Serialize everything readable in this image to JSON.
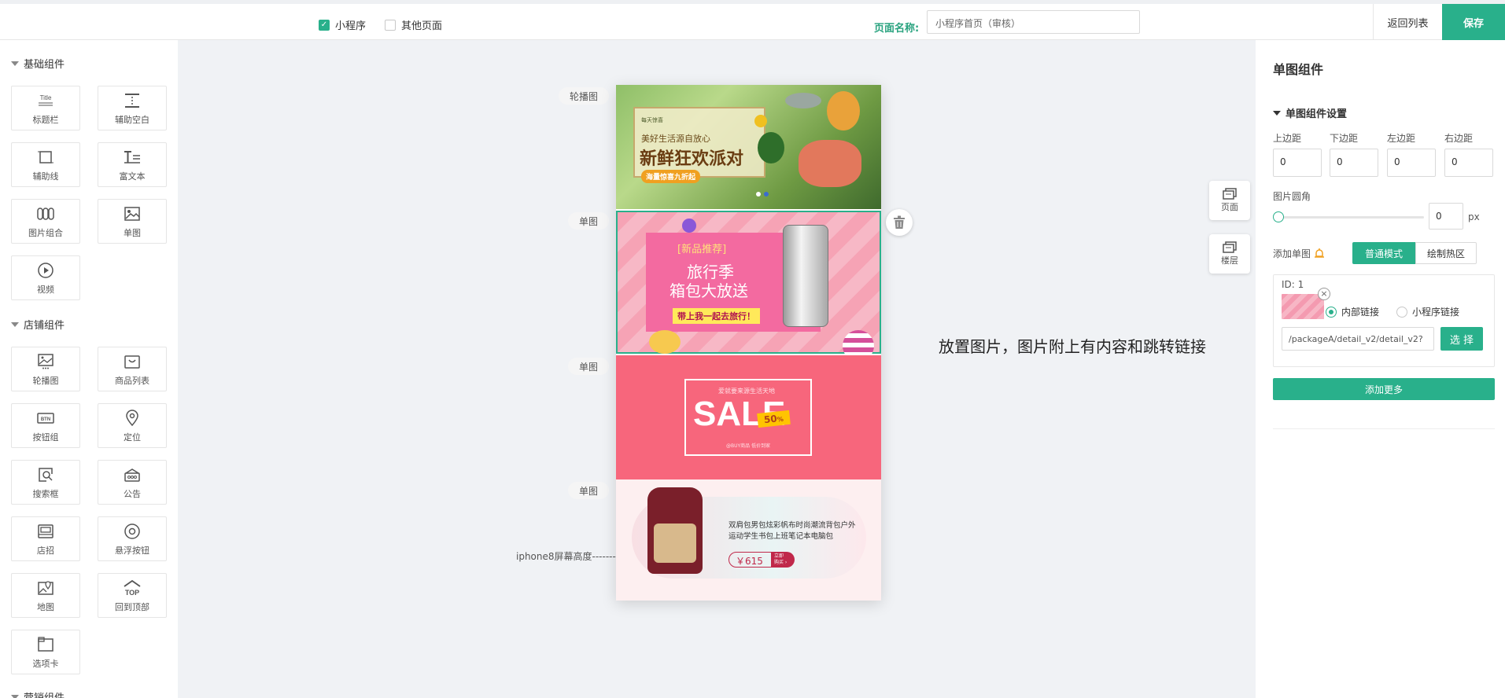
{
  "topbar": {
    "tab_miniprogram": "小程序",
    "tab_other": "其他页面",
    "page_name_label": "页面名称:",
    "page_name_value": "小程序首页（审核）",
    "back_label": "返回列表",
    "save_label": "保存"
  },
  "sidebar": {
    "basic_title": "基础组件",
    "basic": [
      {
        "icon": "title-icon",
        "label": "标题栏"
      },
      {
        "icon": "blank-icon",
        "label": "辅助空白"
      },
      {
        "icon": "line-icon",
        "label": "辅助线"
      },
      {
        "icon": "richtext-icon",
        "label": "富文本"
      },
      {
        "icon": "image-group-icon",
        "label": "图片组合"
      },
      {
        "icon": "image-icon",
        "label": "单图"
      },
      {
        "icon": "video-icon",
        "label": "视频"
      }
    ],
    "shop_title": "店铺组件",
    "shop": [
      {
        "icon": "carousel-icon",
        "label": "轮播图"
      },
      {
        "icon": "goods-list-icon",
        "label": "商品列表"
      },
      {
        "icon": "button-group-icon",
        "label": "按钮组"
      },
      {
        "icon": "location-icon",
        "label": "定位"
      },
      {
        "icon": "search-box-icon",
        "label": "搜索框"
      },
      {
        "icon": "notice-icon",
        "label": "公告"
      },
      {
        "icon": "store-sign-icon",
        "label": "店招"
      },
      {
        "icon": "float-button-icon",
        "label": "悬浮按钮"
      },
      {
        "icon": "map-icon",
        "label": "地图"
      },
      {
        "icon": "back-top-icon",
        "label": "回到顶部"
      },
      {
        "icon": "tab-card-icon",
        "label": "选项卡"
      }
    ],
    "marketing_title": "营销组件",
    "title_icon_text": "Title",
    "btn_icon_text": "BTN",
    "top_icon_text": "TOP"
  },
  "canvas": {
    "labels": [
      "轮播图",
      "单图",
      "单图",
      "单图"
    ],
    "iphone_label": "iphone8屏幕高度-------",
    "hint": "放置图片，图片附上有内容和跳转链接",
    "tool_page": "页面",
    "tool_floor": "楼层",
    "banner1": {
      "tag": "每天惊喜",
      "sub": "美好生活源自放心",
      "main": "新鲜狂欢派对",
      "badge": "海量惊喜九折起"
    },
    "banner2": {
      "tag": "[新品推荐]",
      "line1": "旅行季",
      "line2": "箱包大放送",
      "badge": "带上我一起去旅行！"
    },
    "banner3": {
      "small": "爱就要来源生活天地",
      "big": "SALE",
      "ribbon": "50",
      "ribbon_unit": "%",
      "bottom": "@BUY商品 低价到家"
    },
    "banner4": {
      "line1": "双肩包男包炫彩帆布时尚潮流背包户外",
      "line2": "运动学生书包上班笔记本电脑包",
      "price": "￥615",
      "buy_line1": "立即",
      "buy_line2": "购买 ›"
    }
  },
  "panel": {
    "title": "单图组件",
    "settings_title": "单图组件设置",
    "margin_labels": [
      "上边距",
      "下边距",
      "左边距",
      "右边距"
    ],
    "margin_values": [
      "0",
      "0",
      "0",
      "0"
    ],
    "corner_label": "图片圆角",
    "corner_value": "0",
    "corner_unit": "px",
    "corner_level": 0,
    "add_label": "添加单图",
    "mode_normal": "普通模式",
    "mode_hotzone": "绘制热区",
    "item_id": "ID:  1",
    "radio_internal": "内部链接",
    "radio_miniprogram": "小程序链接",
    "link_value": "/packageA/detail_v2/detail_v2?",
    "select_label": "选 择",
    "add_more_label": "添加更多",
    "accent_color": "#29b08b"
  }
}
